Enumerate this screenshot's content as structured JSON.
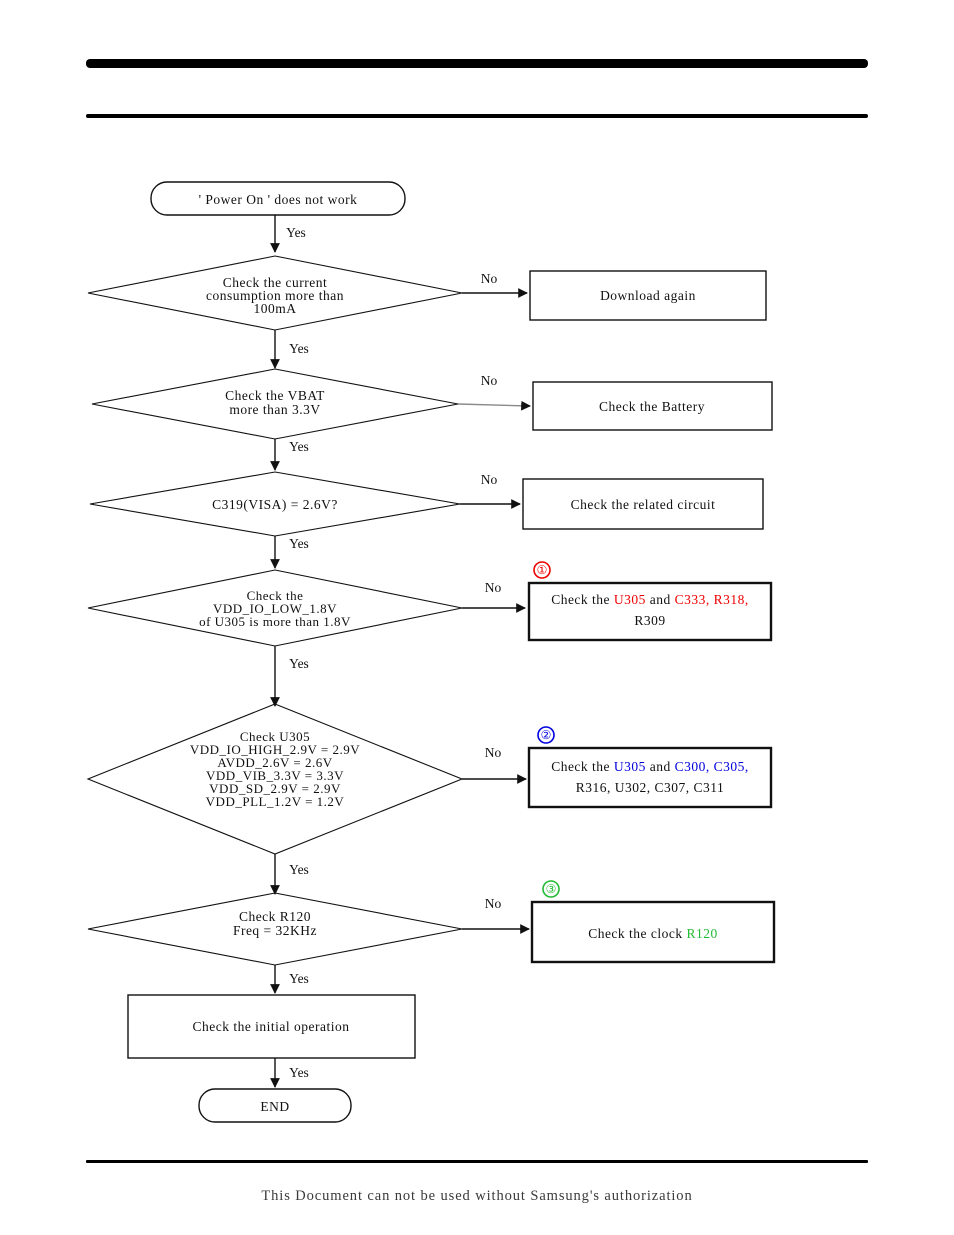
{
  "page": {
    "footer_note": "This Document can not be used without Samsung's authorization"
  },
  "colors": {
    "ink": "#111111",
    "red": "#ee0000",
    "blue": "#0000dd",
    "green": "#22bb33"
  },
  "flowchart": {
    "type": "flowchart",
    "title": "'Power On' does not work troubleshooting",
    "start": {
      "label": "' Power On ' does not work"
    },
    "end": {
      "label": "END"
    },
    "edge_labels": {
      "yes": "Yes",
      "no": "No"
    },
    "decisions": [
      {
        "id": "current-consumption",
        "lines": [
          "Check the current",
          "consumption more than",
          "100mA"
        ],
        "no_target": "download-again",
        "yes_target": "vbat"
      },
      {
        "id": "vbat",
        "lines": [
          "Check the VBAT",
          "more than 3.3V"
        ],
        "no_target": "check-battery",
        "yes_target": "c319"
      },
      {
        "id": "c319",
        "lines": [
          "C319(VISA) = 2.6V?"
        ],
        "no_target": "related-circuit",
        "yes_target": "vdd-io-low"
      },
      {
        "id": "vdd-io-low",
        "lines": [
          "Check the",
          "VDD_IO_LOW_1.8V",
          "of U305 is more than  1.8V"
        ],
        "no_target": "action-1",
        "yes_target": "u305-rails"
      },
      {
        "id": "u305-rails",
        "lines": [
          "Check U305",
          "VDD_IO_HIGH_2.9V = 2.9V",
          "AVDD_2.6V = 2.6V",
          "VDD_VIB_3.3V = 3.3V",
          "VDD_SD_2.9V = 2.9V",
          "VDD_PLL_1.2V = 1.2V"
        ],
        "no_target": "action-2",
        "yes_target": "r120-clock"
      },
      {
        "id": "r120-clock",
        "lines": [
          "Check R120",
          "Freq = 32KHz"
        ],
        "no_target": "action-3",
        "yes_target": "initial-operation"
      }
    ],
    "process_boxes": [
      {
        "id": "download-again",
        "label": "Download again"
      },
      {
        "id": "check-battery",
        "label": "Check the Battery"
      },
      {
        "id": "related-circuit",
        "label": "Check the related circuit"
      },
      {
        "id": "initial-operation",
        "label": "Check the initial operation"
      }
    ],
    "action_boxes": [
      {
        "id": "action-1",
        "badge": "①",
        "color": "#ee0000",
        "line1_plain_a": "Check the ",
        "line1_accent_a": "U305",
        "line1_plain_b": " and ",
        "line1_accent_b": "C333, R318,",
        "line2_accent": "R309"
      },
      {
        "id": "action-2",
        "badge": "②",
        "color": "#0000dd",
        "line1_plain_a": "Check the ",
        "line1_accent_a": "U305",
        "line1_plain_b": " and ",
        "line1_accent_b": "C300, C305,",
        "line2_accent": "R316, U302, C307, C311"
      },
      {
        "id": "action-3",
        "badge": "③",
        "color": "#22bb33",
        "line1_plain_a": "Check the clock ",
        "line1_accent_a": "R120",
        "line1_plain_b": "",
        "line1_accent_b": "",
        "line2_accent": ""
      }
    ]
  }
}
